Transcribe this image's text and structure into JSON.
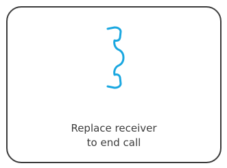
{
  "screen": {
    "icon": "phone-receiver-icon",
    "accent_color": "#1aa7e0",
    "message_line1": "Replace receiver",
    "message_line2": "to end call"
  }
}
